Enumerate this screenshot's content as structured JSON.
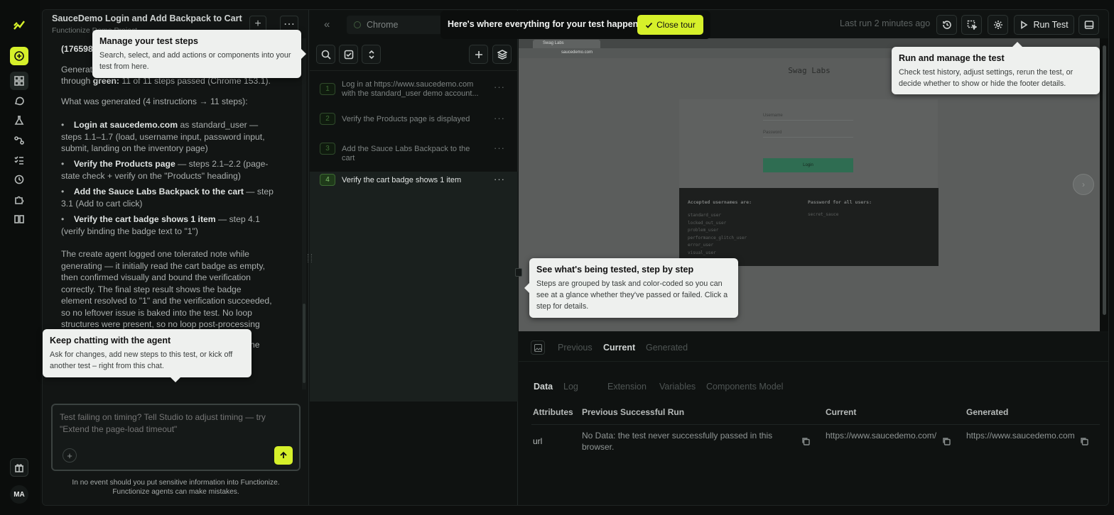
{
  "rail": {
    "user_initials": "MA"
  },
  "chat": {
    "title": "SauceDemo Login and Add Backpack to Cart",
    "subtitle": "Functionize Demo Project",
    "partial_line": "(176598",
    "gen_line1": "Generat",
    "gen_line2_pre": "through ",
    "gen_line2_bold": "green:",
    "gen_line2_post": " 11 of 11 steps passed (Chrome 153.1).",
    "summary_heading": "What was generated (4 instructions → 11 steps):",
    "bullets": [
      {
        "bold": "Login at saucedemo.com",
        "text": " as standard_user — steps 1.1–1.7 (load, username input, password input, submit, landing on the inventory page)"
      },
      {
        "bold": "Verify the Products page",
        "text": " — steps 2.1–2.2 (page-state check + verify on the \"Products\" heading)"
      },
      {
        "bold": "Add the Sauce Labs Backpack to the cart",
        "text": " — step 3.1 (Add to cart click)"
      },
      {
        "bold": "Verify the cart badge shows 1 item",
        "text": " — step 4.1 (verify binding the badge text to \"1\")"
      }
    ],
    "paragraph": "The create agent logged one tolerated note while generating — it initially read the cart badge as empty, then confirmed visually and bound the verification correctly. The final step result shows the badge element resolved to \"1\" and the verification succeeded, so no leftover issue is baked into the test. No loop structures were present, so no loop post-processing was needed.",
    "cut_text": "he",
    "composer_placeholder": "Test failing on timing? Tell Studio to adjust timing — try \"Extend the page-load timeout\"",
    "disclaimer_line1": "In no event should you put sensitive information into Functionize.",
    "disclaimer_line2": "Functionize agents can make mistakes."
  },
  "steps_panel": {
    "browser_label": "Chrome",
    "steps": [
      {
        "num": "1",
        "text": "Log in at https://www.saucedemo.com with the standard_user demo account..."
      },
      {
        "num": "2",
        "text": "Verify the Products page is displayed"
      },
      {
        "num": "3",
        "text": "Add the Sauce Labs Backpack to the cart"
      },
      {
        "num": "4",
        "text": "Verify the cart badge shows 1 item"
      }
    ]
  },
  "topbar": {
    "last_run": "Last run 2 minutes ago",
    "run_test_label": "Run Test"
  },
  "tour": {
    "banner_text": "Here's where everything for your test happens.",
    "close_label": "Close tour"
  },
  "browser_preview": {
    "tab_title": "Swag Labs",
    "url": "saucedemo.com",
    "app_title": "Swag Labs",
    "username_placeholder": "Username",
    "password_placeholder": "Password",
    "login_label": "Login",
    "accepted_heading": "Accepted usernames are:",
    "usernames": [
      "standard_user",
      "locked_out_user",
      "problem_user",
      "performance_glitch_user",
      "error_user",
      "visual_user"
    ],
    "password_heading": "Password for all users:",
    "password_value": "secret_sauce"
  },
  "details": {
    "view_tabs": [
      "Previous",
      "Current",
      "Generated"
    ],
    "data_tabs": [
      "Data",
      "Log",
      "Extension",
      "Variables",
      "Components Model"
    ],
    "columns": [
      "Attributes",
      "Previous Successful Run",
      "Current",
      "Generated"
    ],
    "row": {
      "attribute": "url",
      "previous": "No Data: the test never successfully passed in this browser.",
      "current": "https://www.saucedemo.com/",
      "generated": "https://www.saucedemo.com"
    }
  },
  "tips": {
    "steps": {
      "title": "Manage your test steps",
      "body": "Search, select, and add actions or components into your test from here."
    },
    "run": {
      "title": "Run and manage the test",
      "body": "Check test history, adjust settings, rerun the test, or decide whether to show or hide the footer details."
    },
    "see": {
      "title": "See what's being tested, step by step",
      "body": "Steps are grouped by task and color-coded so you can see at a glance whether they've passed or failed. Click a step for details."
    },
    "chat": {
      "title": "Keep chatting with the agent",
      "body": "Ask for changes, add new steps to this test, or kick off another test – right from this chat."
    }
  },
  "colors": {
    "accent": "#d6f02a",
    "tooltip_bg": "#eef0ee",
    "step_green": "#3e6d34"
  }
}
